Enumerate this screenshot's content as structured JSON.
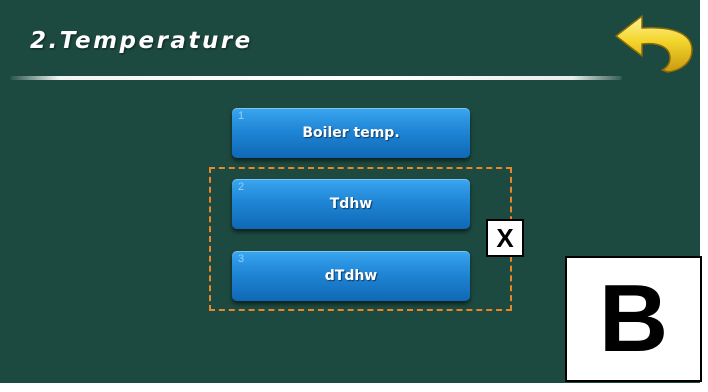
{
  "header": {
    "title": "2.Temperature"
  },
  "menu": {
    "items": [
      {
        "number": "1",
        "label": "Boiler temp."
      },
      {
        "number": "2",
        "label": "Tdhw"
      },
      {
        "number": "3",
        "label": "dTdhw"
      }
    ]
  },
  "annotations": {
    "x_label": "X",
    "b_label": "B",
    "highlight_color": "#e8862a"
  },
  "icons": {
    "back": "back-arrow-icon"
  },
  "colors": {
    "background": "#1d4a40",
    "button": "#1f86d6",
    "back_arrow": "#f3d52b"
  }
}
